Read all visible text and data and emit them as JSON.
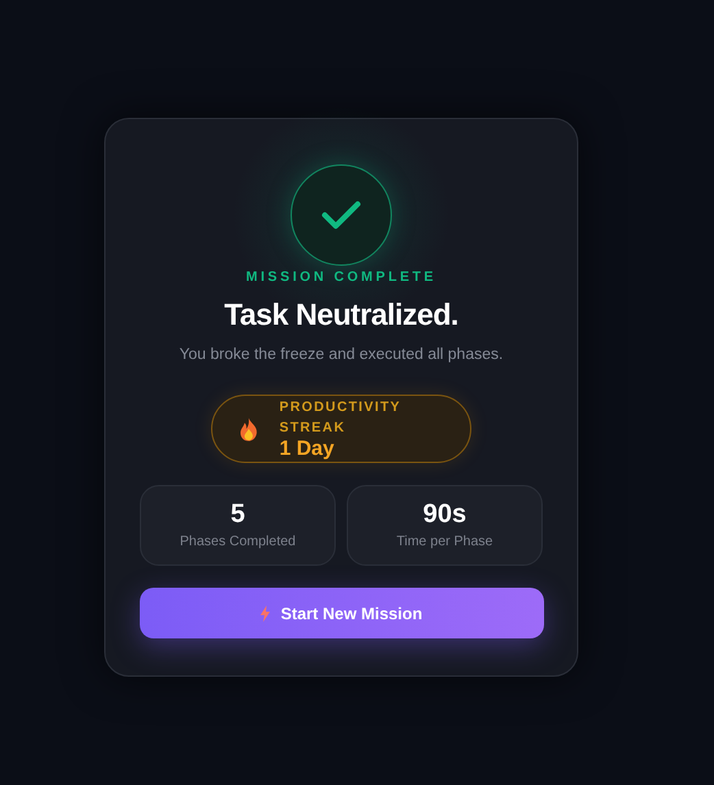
{
  "eyebrow": "MISSION COMPLETE",
  "title": "Task Neutralized.",
  "subtitle": "You broke the freeze and executed all phases.",
  "streak": {
    "label": "PRODUCTIVITY STREAK",
    "value": "1 Day"
  },
  "stats": [
    {
      "value": "5",
      "label": "Phases Completed"
    },
    {
      "value": "90s",
      "label": "Time per Phase"
    }
  ],
  "button": {
    "label": "Start New Mission"
  }
}
